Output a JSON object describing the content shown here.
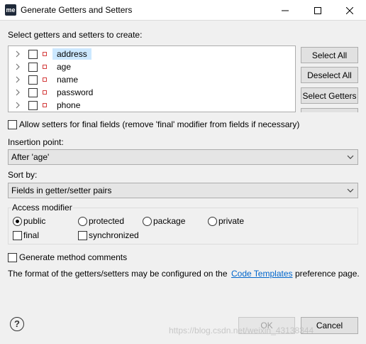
{
  "window": {
    "icon_text": "me",
    "title": "Generate Getters and Setters"
  },
  "select_label": "Select getters and setters to create:",
  "fields": [
    {
      "name": "address",
      "selected": true
    },
    {
      "name": "age",
      "selected": false
    },
    {
      "name": "name",
      "selected": false
    },
    {
      "name": "password",
      "selected": false
    },
    {
      "name": "phone",
      "selected": false
    }
  ],
  "side_buttons": {
    "select_all": "Select All",
    "deselect_all": "Deselect All",
    "select_getters": "Select Getters"
  },
  "allow_setters_label": "Allow setters for final fields (remove 'final' modifier from fields if necessary)",
  "insertion_point": {
    "label": "Insertion point:",
    "value": "After 'age'"
  },
  "sort_by": {
    "label": "Sort by:",
    "value": "Fields in getter/setter pairs"
  },
  "access_modifier": {
    "title": "Access modifier",
    "options": [
      "public",
      "protected",
      "package",
      "private"
    ],
    "selected": "public",
    "final_label": "final",
    "synchronized_label": "synchronized"
  },
  "generate_comments_label": "Generate method comments",
  "format_note": {
    "before": "The format of the getters/setters may be configured on the",
    "link": "Code Templates",
    "after": "preference page."
  },
  "footer": {
    "ok_label": "OK",
    "cancel_label": "Cancel",
    "help_symbol": "?"
  },
  "watermark": "https://blog.csdn.net/weixin_43138344",
  "colors": {
    "link": "#0066cc",
    "selection": "#cce8ff",
    "field_icon": "#d43c3c"
  }
}
